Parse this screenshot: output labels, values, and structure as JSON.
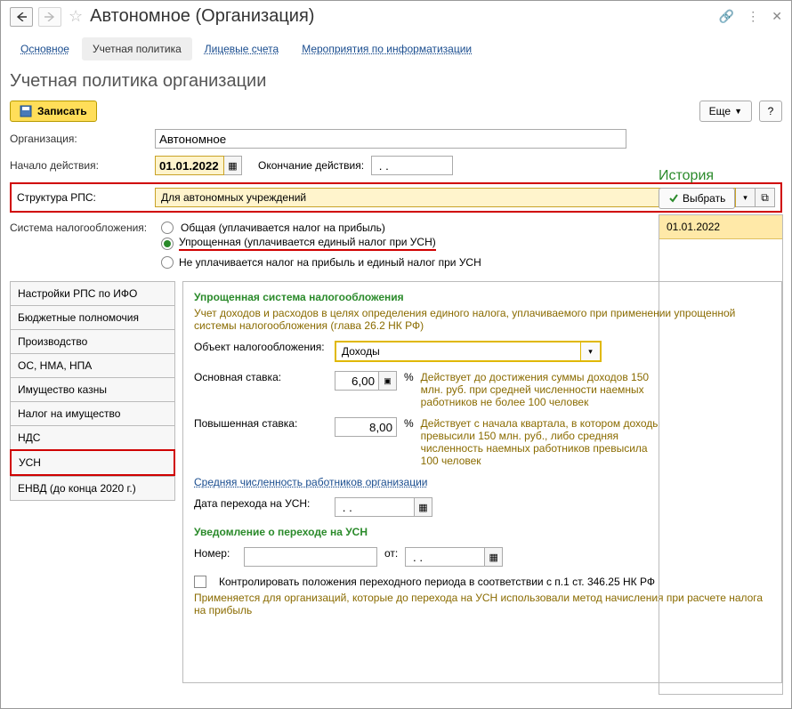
{
  "title": "Автономное (Организация)",
  "tabs": [
    "Основное",
    "Учетная политика",
    "Лицевые счета",
    "Мероприятия по информатизации"
  ],
  "active_tab": 1,
  "page_heading": "Учетная политика организации",
  "toolbar": {
    "save_label": "Записать",
    "more_label": "Еще"
  },
  "labels": {
    "org": "Организация:",
    "start": "Начало действия:",
    "end": "Окончание действия:",
    "rps": "Структура РПС:",
    "tax_system": "Система налогообложения:"
  },
  "org_value": "Автономное",
  "start_value": "01.01.2022",
  "end_value": " . .",
  "rps_value": "Для автономных учреждений",
  "tax_options": [
    "Общая (уплачивается налог на прибыль)",
    "Упрощенная (уплачивается единый налог при УСН)",
    "Не уплачивается налог на прибыль и единый налог при УСН"
  ],
  "tax_selected": 1,
  "side_nav": [
    "Настройки РПС по ИФО",
    "Бюджетные полномочия",
    "Производство",
    "ОС, НМА, НПА",
    "Имущество казны",
    "Налог на имущество",
    "НДС",
    "УСН",
    "ЕНВД (до конца 2020 г.)"
  ],
  "side_selected": 7,
  "usn": {
    "title": "Упрощенная система налогообложения",
    "desc": "Учет доходов и расходов в целях определения единого налога, уплачиваемого при применении упрощенной системы налогообложения (глава 26.2 НК РФ)",
    "obj_label": "Объект налогообложения:",
    "obj_value": "Доходы",
    "base_rate_label": "Основная ставка:",
    "base_rate": "6,00",
    "base_hint": "Действует до достижения суммы доходов 150 млн. руб. при средней численности наемных работников не более 100 человек",
    "high_rate_label": "Повышенная ставка:",
    "high_rate": "8,00",
    "high_hint": "Действует с начала квартала, в котором доходы превысили 150 млн. руб., либо средняя численность наемных работников превысила 100 человек",
    "percent": "%",
    "avg_link": "Средняя численность работников организации",
    "date_label": "Дата перехода на УСН:",
    "date_value": " . .",
    "notice_title": "Уведомление о переходе на УСН",
    "num_label": "Номер:",
    "ot_label": "от:",
    "ot_value": " . .",
    "chk_label": "Контролировать положения переходного периода в соответствии с п.1 ст. 346.25 НК РФ",
    "chk_hint": "Применяется для организаций, которые до перехода на УСН использовали метод начисления при расчете налога на прибыль"
  },
  "history": {
    "title": "История",
    "select_btn": "Выбрать",
    "items": [
      "01.01.2022"
    ]
  }
}
